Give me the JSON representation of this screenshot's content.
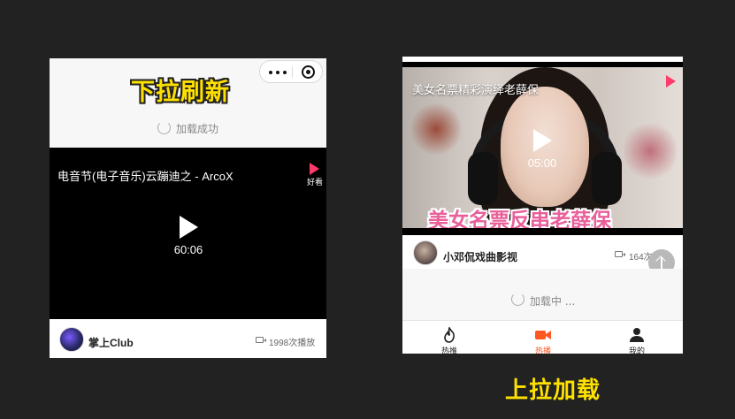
{
  "left_demo": {
    "caption": "下拉刷新",
    "status": "加载成功",
    "video": {
      "title": "电音节(电子音乐)云蹦迪之 - ArcoX",
      "duration": "60:06",
      "brand": "好看"
    },
    "footer": {
      "author": "掌上Club",
      "views": "1998次播放"
    }
  },
  "right_demo": {
    "caption": "上拉加载",
    "video": {
      "title": "美女名票精彩演绎老薛保",
      "duration": "05:00",
      "overlay_text": "美女名票反串老薛保"
    },
    "footer": {
      "author": "小邓侃戏曲影视",
      "views": "164次播放"
    },
    "status": "加载中 ...",
    "tabs": [
      {
        "label": "热推",
        "icon": "flame-icon"
      },
      {
        "label": "热播",
        "icon": "video-camera-icon"
      },
      {
        "label": "我的",
        "icon": "person-icon"
      }
    ],
    "active_tab_color": "#ff5722"
  }
}
